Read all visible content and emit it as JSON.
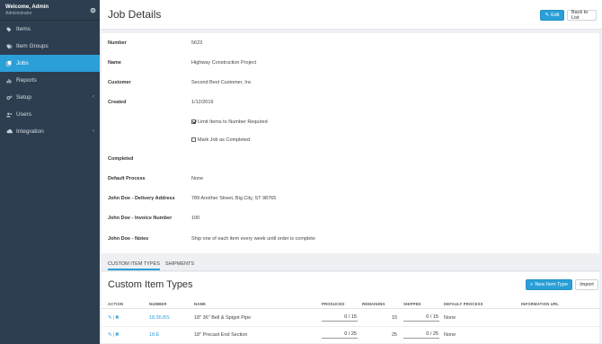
{
  "sidebar": {
    "welcome": "Welcome, Admin",
    "role": "Administrator",
    "items": [
      {
        "label": "Items",
        "icon": "tag-icon"
      },
      {
        "label": "Item Groups",
        "icon": "tags-icon"
      },
      {
        "label": "Jobs",
        "icon": "copy-icon",
        "active": true
      },
      {
        "label": "Reports",
        "icon": "bar-chart-icon"
      },
      {
        "label": "Setup",
        "icon": "cogs-icon",
        "caret": true
      },
      {
        "label": "Users",
        "icon": "users-icon"
      },
      {
        "label": "Integration",
        "icon": "cloud-icon",
        "caret": true
      }
    ]
  },
  "header": {
    "title": "Job Details",
    "edit_label": "Edit",
    "back_label": "Back to List"
  },
  "details": {
    "number_label": "Number",
    "number": "5623",
    "name_label": "Name",
    "name": "Highway Construction Project",
    "customer_label": "Customer",
    "customer": "Second Best Customer, Inc",
    "created_label": "Created",
    "created": "1/12/2019",
    "limit_label": "Limit Items to Number Required",
    "mark_label": "Mark Job as Completed",
    "completed_label": "Completed",
    "completed": "",
    "default_process_label": "Default Process",
    "default_process": "None",
    "delivery_label": "John Doe - Delivery Address",
    "delivery": "789 Another Street, Big City, ST 98765",
    "invoice_label": "John Doe - Invoice Number",
    "invoice": "100",
    "notes_label": "John Doe - Notes",
    "notes": "Ship one of each item every week until order is complete"
  },
  "tabs": {
    "custom_item_types": "CUSTOM ITEM TYPES",
    "shipments": "SHIPMENTS"
  },
  "items": {
    "title": "Custom Item Types",
    "new_button": "New Item Type",
    "import_button": "Import",
    "headers": {
      "action": "ACTION",
      "number": "NUMBER",
      "name": "NAME",
      "produced": "PRODUCED",
      "remaining": "REMAINING",
      "shipped": "SHIPPED",
      "default_process": "DEFAULT PROCESS",
      "info_url": "INFORMATION URL"
    },
    "rows": [
      {
        "number": "18.36.BS",
        "name": "18\" 36\" Bell & Spigot Pipe",
        "produced": "0 / 15",
        "remaining": "15",
        "shipped": "0 / 15",
        "process": "None"
      },
      {
        "number": "18.E",
        "name": "18\" Precast End Section",
        "produced": "0 / 25",
        "remaining": "25",
        "shipped": "0 / 25",
        "process": "None"
      }
    ]
  },
  "colors": {
    "accent": "#2a9fd8",
    "sidebar": "#2c3e50"
  }
}
